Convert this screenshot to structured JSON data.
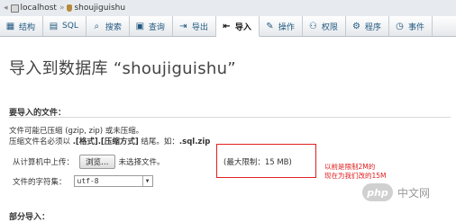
{
  "breadcrumb": {
    "server": "localhost",
    "database": "shoujiguishu"
  },
  "tabs": [
    {
      "label": "结构",
      "icon": "structure-icon"
    },
    {
      "label": "SQL",
      "icon": "sql-icon"
    },
    {
      "label": "搜索",
      "icon": "search-icon"
    },
    {
      "label": "查询",
      "icon": "query-icon"
    },
    {
      "label": "导出",
      "icon": "export-icon"
    },
    {
      "label": "导入",
      "icon": "import-icon",
      "active": true
    },
    {
      "label": "操作",
      "icon": "wrench-icon"
    },
    {
      "label": "权限",
      "icon": "privileges-icon"
    },
    {
      "label": "程序",
      "icon": "routines-icon"
    },
    {
      "label": "事件",
      "icon": "events-icon"
    }
  ],
  "page_title": "导入到数据库 “shoujiguishu”",
  "file_section": {
    "title": "要导入的文件：",
    "note_line1": "文件可能已压缩 (gzip, zip) 或未压缩。",
    "note_line2_a": "压缩文件名必须以 ",
    "note_line2_b": ".[格式].[压缩方式]",
    "note_line2_c": " 结尾。如：",
    "note_line2_d": ".sql.zip",
    "upload_label": "从计算机中上传：",
    "browse_button": "浏览…",
    "no_file_text": "未选择文件。",
    "max_limit": "(最大限制：15 MB)",
    "charset_label": "文件的字符集：",
    "charset_value": "utf-8"
  },
  "annotation": {
    "line1": "以前是限制2M的",
    "line2": "现在为我们改的15M"
  },
  "partial_section": {
    "title": "部分导入："
  },
  "watermark": {
    "badge": "php",
    "text": "中文网"
  },
  "colors": {
    "accent_red": "#e02020",
    "link_blue": "#235a81"
  }
}
